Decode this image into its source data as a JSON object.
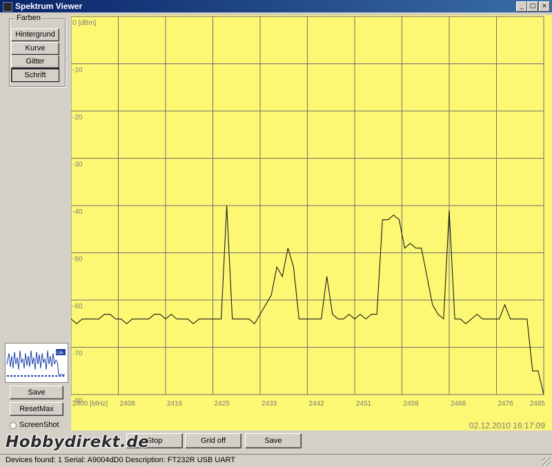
{
  "window": {
    "title": "Spektrum Viewer",
    "minimize": "_",
    "maximize": "□",
    "close": "×"
  },
  "left_panel": {
    "group_label": "Farben",
    "buttons": [
      "Hintergrund",
      "Kurve",
      "Gitter",
      "Schrift"
    ],
    "save_label": "Save",
    "resetmax_label": "ResetMax",
    "screenshot_label": "ScreenShot",
    "thumbnail_tag": "Lite"
  },
  "bottom_buttons": {
    "stop": "Stop",
    "grid": "Grid off",
    "save": "Save"
  },
  "status": "Devices found: 1   Serial: A9004dD0   Description: FT232R USB UART",
  "watermark": "Hobbydirekt.de",
  "timestamp": "02.12.2010 16:17:09",
  "colors": {
    "background": "#fcf873",
    "grid": "#6f6f6f",
    "curve": "#1a1a1a"
  },
  "chart_data": {
    "type": "line",
    "title": "",
    "xlabel": "[MHz]",
    "ylabel": "[dBm]",
    "xlim": [
      2400,
      2485
    ],
    "ylim": [
      -80,
      0
    ],
    "x_tick_labels": [
      "2400 [MHz]",
      "2408",
      "2416",
      "2425",
      "2433",
      "2442",
      "2451",
      "2459",
      "2468",
      "2476",
      "2485"
    ],
    "y_tick_labels": [
      "0 [dBm]",
      "-10",
      "-20",
      "-30",
      "-40",
      "-50",
      "-60",
      "-70",
      "-80"
    ],
    "grid": true,
    "series": [
      {
        "values": [
          [
            2400,
            -64
          ],
          [
            2401,
            -65
          ],
          [
            2402,
            -64
          ],
          [
            2403,
            -64
          ],
          [
            2404,
            -64
          ],
          [
            2405,
            -64
          ],
          [
            2406,
            -63
          ],
          [
            2407,
            -63
          ],
          [
            2408,
            -64
          ],
          [
            2409,
            -64
          ],
          [
            2410,
            -65
          ],
          [
            2411,
            -64
          ],
          [
            2412,
            -64
          ],
          [
            2413,
            -64
          ],
          [
            2414,
            -64
          ],
          [
            2415,
            -63
          ],
          [
            2416,
            -63
          ],
          [
            2417,
            -64
          ],
          [
            2418,
            -63
          ],
          [
            2419,
            -64
          ],
          [
            2420,
            -64
          ],
          [
            2421,
            -64
          ],
          [
            2422,
            -65
          ],
          [
            2423,
            -64
          ],
          [
            2424,
            -64
          ],
          [
            2425,
            -64
          ],
          [
            2426,
            -64
          ],
          [
            2427,
            -64
          ],
          [
            2428,
            -40
          ],
          [
            2429,
            -64
          ],
          [
            2430,
            -64
          ],
          [
            2431,
            -64
          ],
          [
            2432,
            -64
          ],
          [
            2433,
            -65
          ],
          [
            2434,
            -63
          ],
          [
            2435,
            -61
          ],
          [
            2436,
            -59
          ],
          [
            2437,
            -53
          ],
          [
            2438,
            -55
          ],
          [
            2439,
            -49
          ],
          [
            2440,
            -53
          ],
          [
            2441,
            -64
          ],
          [
            2442,
            -64
          ],
          [
            2443,
            -64
          ],
          [
            2444,
            -64
          ],
          [
            2445,
            -64
          ],
          [
            2446,
            -55
          ],
          [
            2447,
            -63
          ],
          [
            2448,
            -64
          ],
          [
            2449,
            -64
          ],
          [
            2450,
            -63
          ],
          [
            2451,
            -64
          ],
          [
            2452,
            -63
          ],
          [
            2453,
            -64
          ],
          [
            2454,
            -63
          ],
          [
            2455,
            -63
          ],
          [
            2456,
            -43
          ],
          [
            2457,
            -43
          ],
          [
            2458,
            -42
          ],
          [
            2459,
            -43
          ],
          [
            2460,
            -49
          ],
          [
            2461,
            -48
          ],
          [
            2462,
            -49
          ],
          [
            2463,
            -49
          ],
          [
            2464,
            -55
          ],
          [
            2465,
            -61
          ],
          [
            2466,
            -63
          ],
          [
            2467,
            -64
          ],
          [
            2468,
            -41
          ],
          [
            2469,
            -64
          ],
          [
            2470,
            -64
          ],
          [
            2471,
            -65
          ],
          [
            2472,
            -64
          ],
          [
            2473,
            -63
          ],
          [
            2474,
            -64
          ],
          [
            2475,
            -64
          ],
          [
            2476,
            -64
          ],
          [
            2477,
            -64
          ],
          [
            2478,
            -61
          ],
          [
            2479,
            -64
          ],
          [
            2480,
            -64
          ],
          [
            2481,
            -64
          ],
          [
            2482,
            -64
          ],
          [
            2483,
            -75
          ],
          [
            2484,
            -75
          ],
          [
            2485,
            -80
          ]
        ]
      }
    ]
  }
}
